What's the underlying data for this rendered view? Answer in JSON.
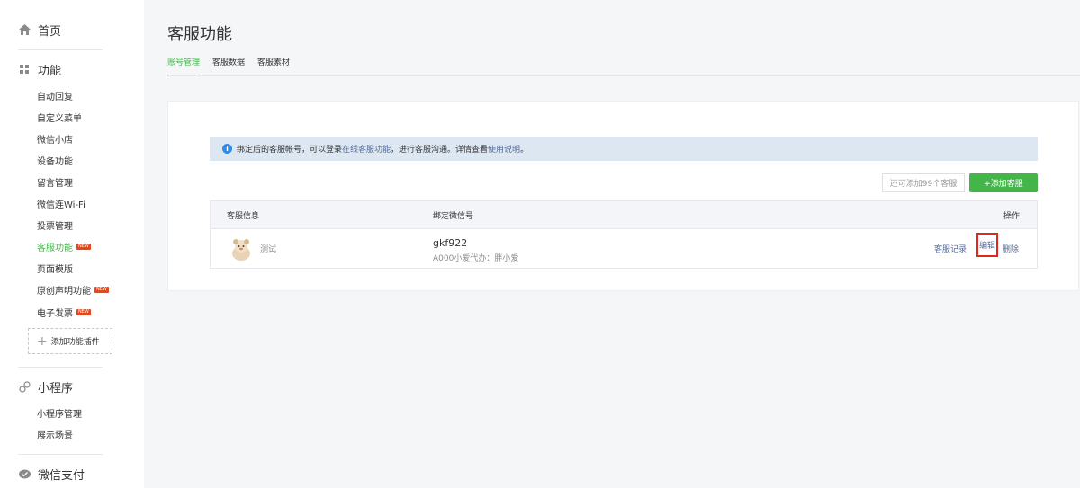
{
  "sidebar": {
    "home": "首页",
    "functions": "功能",
    "function_items": [
      {
        "label": "自动回复",
        "badge": ""
      },
      {
        "label": "自定义菜单",
        "badge": ""
      },
      {
        "label": "微信小店",
        "badge": ""
      },
      {
        "label": "设备功能",
        "badge": ""
      },
      {
        "label": "留言管理",
        "badge": ""
      },
      {
        "label": "微信连Wi-Fi",
        "badge": ""
      },
      {
        "label": "投票管理",
        "badge": ""
      },
      {
        "label": "客服功能",
        "badge": "NEW"
      },
      {
        "label": "页面模版",
        "badge": ""
      },
      {
        "label": "原创声明功能",
        "badge": "NEW"
      },
      {
        "label": "电子发票",
        "badge": "NEW"
      }
    ],
    "add_plugin": "添加功能插件",
    "miniprogram": "小程序",
    "mini_items": [
      "小程序管理",
      "展示场景"
    ],
    "pay": "微信支付"
  },
  "main": {
    "title": "客服功能",
    "tabs": [
      "账号管理",
      "客服数据",
      "客服素材"
    ],
    "notice": {
      "prefix": "绑定后的客服帐号，可以登录",
      "link1": "在线客服功能",
      "middle": "，进行客服沟通。详情查看",
      "link2": "使用说明",
      "suffix": "。"
    },
    "remaining_label": "还可添加99个客服",
    "add_button": "+添加客服",
    "table": {
      "headers": {
        "info": "客服信息",
        "wechat": "绑定微信号",
        "ops": "操作"
      },
      "rows": [
        {
          "name": "测试",
          "wechat_id": "gkf922",
          "wechat_sub": "A000小爱代办：胖小爱",
          "ops": {
            "record": "客服记录",
            "edit": "编辑",
            "delete": "删除"
          }
        }
      ]
    }
  },
  "colors": {
    "accent": "#44b549",
    "link": "#576b95",
    "highlight": "#e0271b"
  }
}
